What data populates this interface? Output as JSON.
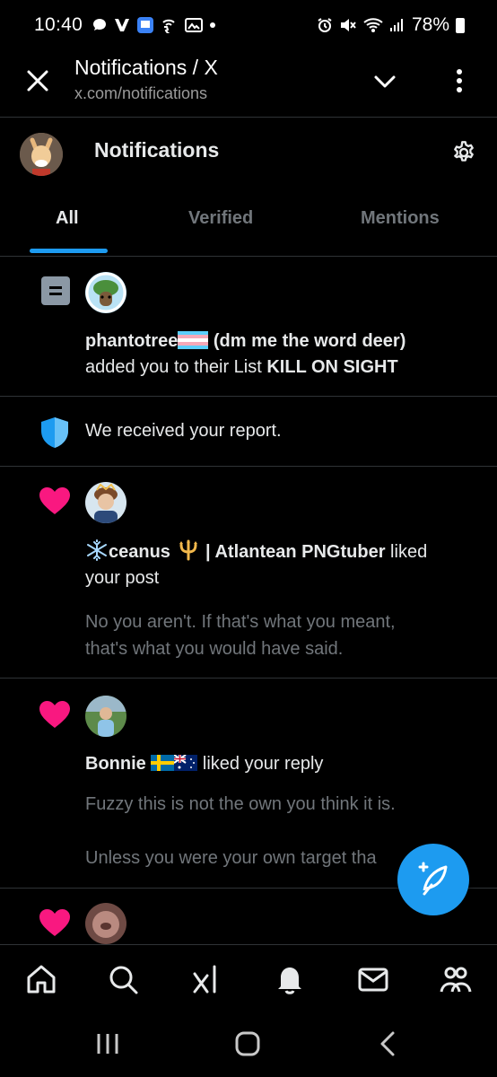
{
  "status_bar": {
    "time": "10:40",
    "battery": "78%",
    "left_icons": [
      "chat-bubble-icon",
      "v-icon",
      "app-icon",
      "wifi-calling-icon",
      "wallpaper-icon",
      "dot-icon"
    ],
    "right_icons": [
      "alarm-icon",
      "mute-icon",
      "wifi-icon",
      "signal-icon",
      "battery-icon"
    ]
  },
  "browser": {
    "title": "Notifications / X",
    "url": "x.com/notifications"
  },
  "header": {
    "title": "Notifications"
  },
  "tabs": [
    {
      "label": "All",
      "active": true
    },
    {
      "label": "Verified",
      "active": false
    },
    {
      "label": "Mentions",
      "active": false
    }
  ],
  "notifications": [
    {
      "type": "list",
      "user": "phantotree",
      "user_suffix": " (dm me the word deer)",
      "action": "added you to their List ",
      "list_name": "KILL ON SIGHT"
    },
    {
      "type": "report",
      "text": "We received your report."
    },
    {
      "type": "like",
      "user_pre": "ceanus",
      "user_post": " | Atlantean PNGtuber",
      "action": " liked",
      "action2": "your post",
      "content": [
        "No you aren't. If that's what you meant,",
        "that's what you would have said."
      ]
    },
    {
      "type": "like",
      "user": "Bonnie",
      "action": " liked your reply",
      "content": [
        "Fuzzy this is not the own you think it is.",
        "",
        "Unless you were your own target tha"
      ]
    },
    {
      "type": "like"
    }
  ],
  "colors": {
    "accent": "#1d9bf0",
    "like": "#f91880",
    "muted": "#71767b",
    "divider": "#2f3336"
  },
  "bottom_nav": [
    "home-icon",
    "search-icon",
    "grok-icon",
    "notifications-icon",
    "messages-icon",
    "communities-icon"
  ],
  "system_nav": [
    "recents-icon",
    "home-button-icon",
    "back-icon"
  ]
}
